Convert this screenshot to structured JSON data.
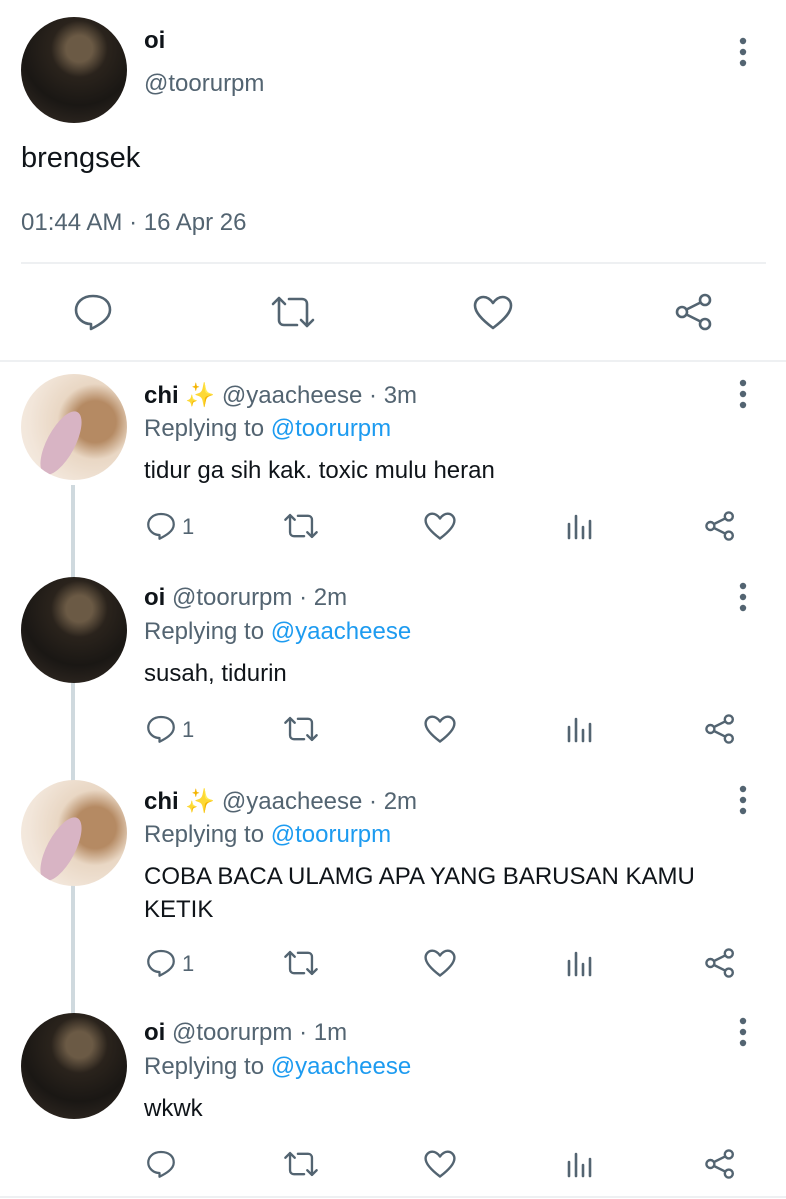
{
  "main_tweet": {
    "display_name": "oi",
    "handle": "@toorurpm",
    "text": "brengsek",
    "timestamp": "01:44 AM · 16 Apr 26",
    "actions": [
      "reply-icon",
      "retweet-icon",
      "like-icon",
      "share-icon"
    ]
  },
  "replies": [
    {
      "display_name": "chi ✨",
      "handle": "@yaacheese",
      "time": "· 3m",
      "replying_label": "Replying to",
      "replying_to": "@toorurpm",
      "text": "tidur ga sih kak. toxic mulu heran",
      "reply_count": "1"
    },
    {
      "display_name": "oi",
      "handle": "@toorurpm",
      "time": "· 2m",
      "replying_label": "Replying to",
      "replying_to": "@yaacheese",
      "text": "susah, tidurin",
      "reply_count": "1"
    },
    {
      "display_name": "chi ✨",
      "handle": "@yaacheese",
      "time": "· 2m",
      "replying_label": "Replying to",
      "replying_to": "@toorurpm",
      "text_line1": "COBA BACA ULAMG APA YANG BARUSAN KAMU",
      "text_line2": "KETIK",
      "reply_count": "1"
    },
    {
      "display_name": "oi",
      "handle": "@toorurpm",
      "time": "· 1m",
      "replying_label": "Replying to",
      "replying_to": "@yaacheese",
      "text": "wkwk",
      "reply_count": ""
    }
  ],
  "colors": {
    "link": "#1d9bf0",
    "muted": "#536471",
    "text": "#0f1419",
    "divider": "#eef0f2"
  }
}
